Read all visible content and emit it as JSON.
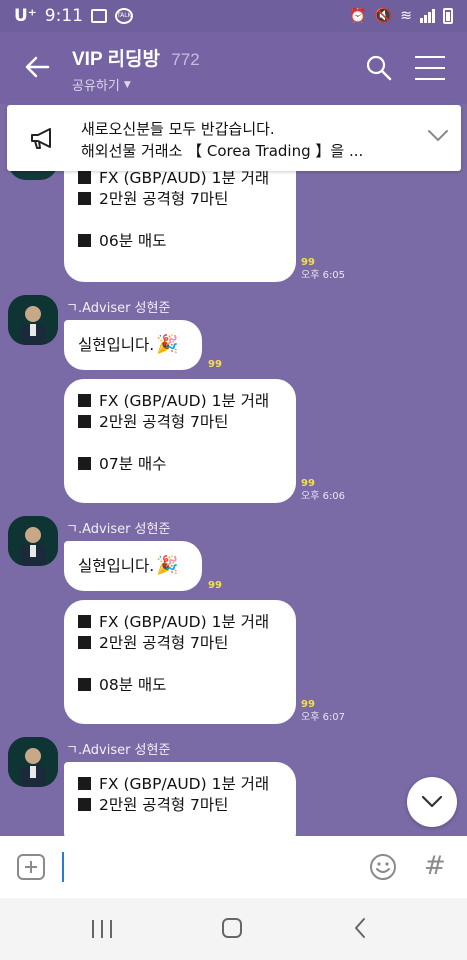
{
  "status_bar": {
    "carrier": "U⁺",
    "time": "9:11",
    "talk_badge": "TALK"
  },
  "header": {
    "title": "VIP 리딩방",
    "member_count": "772",
    "share_label": "공유하기"
  },
  "notice": {
    "line1": "새로오신분들 모두 반갑습니다.",
    "line2": "해외선물 거래소 【 Corea Trading 】을 ..."
  },
  "messages": [
    {
      "lines": [
        "FX (GBP/AUD) 1분 거래",
        "2만원 공격형 7마틴",
        "",
        "06분 매도"
      ],
      "read_count": "99",
      "time": "오후 6:05"
    },
    {
      "sender": "ㄱ.Adviser 성현준",
      "text": "실현입니다.",
      "read_count": "99"
    },
    {
      "lines": [
        "FX (GBP/AUD) 1분 거래",
        "2만원 공격형 7마틴",
        "",
        "07분 매수"
      ],
      "read_count": "99",
      "time": "오후 6:06"
    },
    {
      "sender": "ㄱ.Adviser 성현준",
      "text": "실현입니다.",
      "read_count": "99"
    },
    {
      "lines": [
        "FX (GBP/AUD) 1분 거래",
        "2만원 공격형 7마틴",
        "",
        "08분 매도"
      ],
      "read_count": "99",
      "time": "오후 6:07"
    },
    {
      "sender": "ㄱ.Adviser 성현준",
      "lines": [
        "FX (GBP/AUD) 1분 거래",
        "2만원 공격형 7마틴"
      ]
    }
  ],
  "input": {
    "value": "",
    "hash_label": "#"
  },
  "colors": {
    "chat_bg": "#7a6aa6",
    "header_bg": "#7563a3",
    "read_count": "#f4e04a",
    "cursor": "#2a7ad5"
  },
  "icons": [
    "back-arrow-icon",
    "search-icon",
    "menu-icon",
    "megaphone-icon",
    "chevron-down-icon",
    "party-popper-icon",
    "plus-icon",
    "emoji-icon",
    "hash-icon"
  ]
}
